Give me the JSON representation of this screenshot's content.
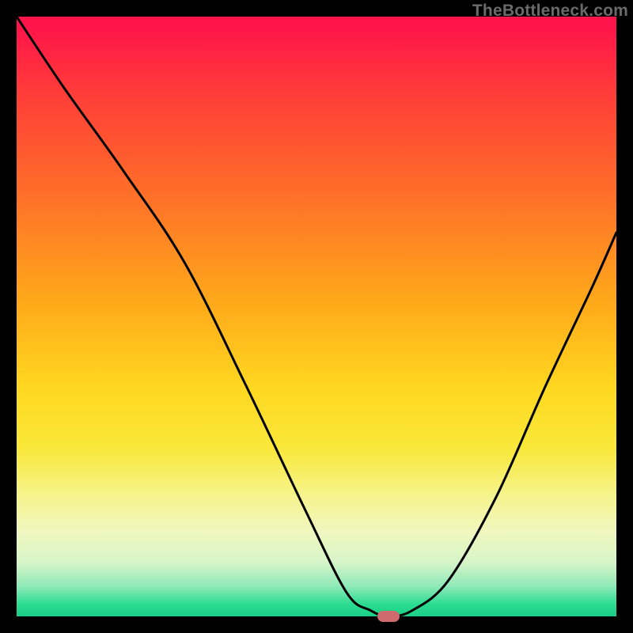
{
  "watermark": "TheBottleneck.com",
  "chart_data": {
    "type": "line",
    "title": "",
    "xlabel": "",
    "ylabel": "",
    "xlim": [
      0,
      100
    ],
    "ylim": [
      0,
      100
    ],
    "grid": false,
    "legend": false,
    "series": [
      {
        "name": "bottleneck-curve",
        "x": [
          0,
          8,
          18,
          28,
          38,
          48,
          55,
          59,
          62,
          66,
          72,
          80,
          88,
          96,
          100
        ],
        "y": [
          100,
          88,
          74,
          59,
          39,
          18,
          4,
          1,
          0,
          1,
          6,
          20,
          38,
          55,
          64
        ],
        "color": "#000000"
      }
    ],
    "marker": {
      "x": 62,
      "y": 0,
      "color": "#cf6a6f"
    },
    "background_gradient": {
      "top": "#ff1549",
      "mid": "#ffd820",
      "bottom": "#1bcf86"
    }
  }
}
